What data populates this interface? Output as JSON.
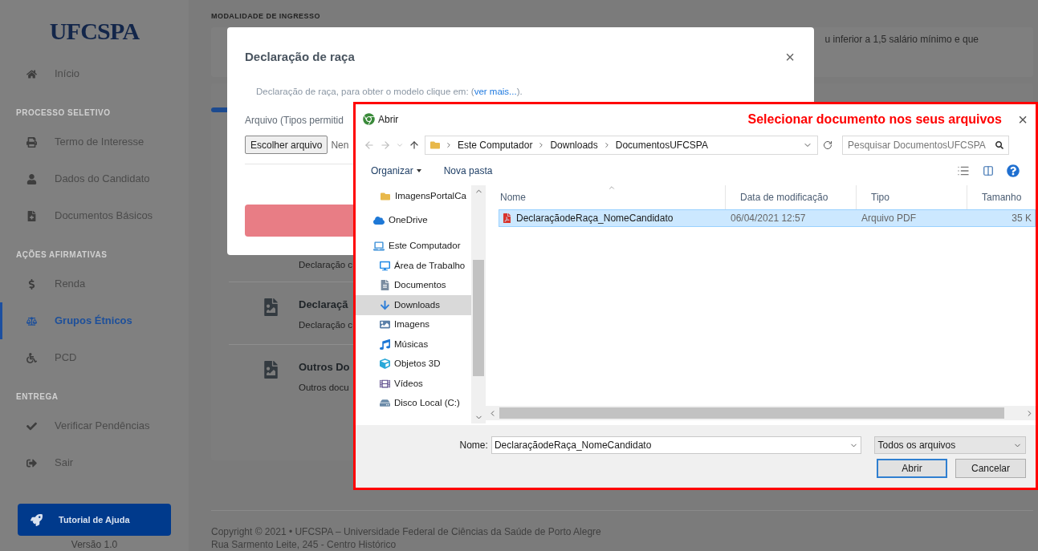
{
  "sidebar": {
    "logo": "UFCSPA",
    "sections": [
      {
        "items": [
          {
            "label": "Início",
            "selected": false
          }
        ]
      },
      {
        "heading": "PROCESSO SELETIVO",
        "items": [
          {
            "label": "Termo de Interesse",
            "selected": false
          },
          {
            "label": "Dados do Candidato",
            "selected": false
          },
          {
            "label": "Documentos Básicos",
            "selected": false
          }
        ]
      },
      {
        "heading": "AÇÕES AFIRMATIVAS",
        "items": [
          {
            "label": "Renda",
            "selected": false
          },
          {
            "label": "Grupos Étnicos",
            "selected": true
          },
          {
            "label": "PCD",
            "selected": false
          }
        ]
      },
      {
        "heading": "ENTREGA",
        "items": [
          {
            "label": "Verificar Pendências",
            "selected": false
          },
          {
            "label": "Sair",
            "selected": false
          }
        ]
      }
    ],
    "help_button": "Tutorial de Ajuda",
    "version": "Versão 1.0"
  },
  "main": {
    "section_label": "MODALIDADE DE INGRESSO",
    "progress": {
      "level": 0.03
    },
    "notice": "u inferior a 1,5 salário mínimo e que",
    "documents": [
      {
        "subtitle": "Declaração c"
      },
      {
        "title": "Declaraçã",
        "subtitle": "Declaração c"
      },
      {
        "title": "Outros Do",
        "subtitle": "Outros docu"
      }
    ],
    "footer": [
      "Copyright © 2021  •  UFCSPA – Universidade Federal de Ciências da Saúde de Porto Alegre",
      "Rua Sarmento Leite, 245 - Centro Histórico"
    ]
  },
  "modal": {
    "title": "Declaração de raça",
    "close": "×",
    "description": {
      "before": "Declaração de raça, para obter o modelo clique em: (",
      "link": "ver mais...",
      "after": ")."
    },
    "file_label": "Arquivo (Tipos permitid",
    "choose_button": "Escolher arquivo",
    "file_status": "Nen"
  },
  "file_dialog": {
    "title": "Abrir",
    "annotation": "Selecionar documento nos seus arquivos",
    "close": "×",
    "breadcrumb": [
      "Este Computador",
      "Downloads",
      "DocumentosUFCSPA"
    ],
    "search": {
      "placeholder": "Pesquisar DocumentosUFCSPA"
    },
    "toolbar": {
      "organize": "Organizar",
      "new_folder": "Nova pasta"
    },
    "nav": [
      {
        "label": "ImagensPortalCa",
        "selected": false
      },
      {
        "label": "OneDrive",
        "selected": false
      },
      {
        "label": "Este Computador",
        "selected": false,
        "children": [
          {
            "label": "Área de Trabalho",
            "selected": false
          },
          {
            "label": "Documentos",
            "selected": false
          },
          {
            "label": "Downloads",
            "selected": true
          },
          {
            "label": "Imagens",
            "selected": false
          },
          {
            "label": "Músicas",
            "selected": false
          },
          {
            "label": "Objetos 3D",
            "selected": false
          },
          {
            "label": "Vídeos",
            "selected": false
          },
          {
            "label": "Disco Local (C:)",
            "selected": false
          }
        ]
      }
    ],
    "columns": [
      "Nome",
      "Data de modificação",
      "Tipo",
      "Tamanho"
    ],
    "files": [
      {
        "name": "DeclaraçãodeRaça_NomeCandidato",
        "modified": "06/04/2021 12:57",
        "type": "Arquivo PDF",
        "size": "35 K",
        "selected": true
      }
    ],
    "name_label": "Nome:",
    "name_value": "DeclaraçãodeRaça_NomeCandidato",
    "filter": "Todos os arquivos",
    "open_button": "Abrir",
    "cancel_button": "Cancelar"
  }
}
